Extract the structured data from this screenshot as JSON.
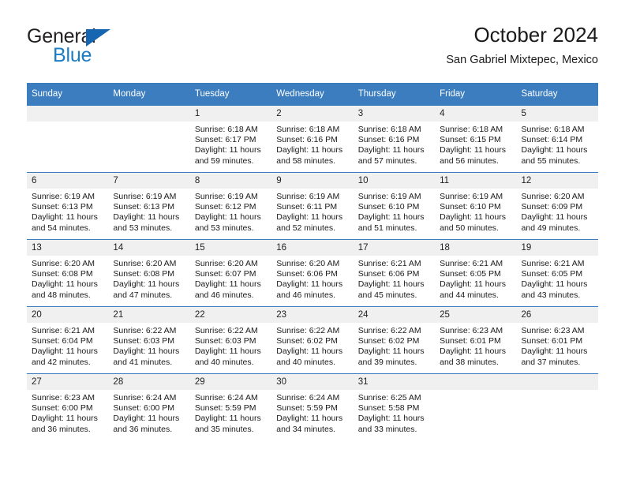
{
  "brand": {
    "name_top": "General",
    "name_bottom": "Blue",
    "triangle_color": "#1565b0",
    "text_color_top": "#231f20",
    "text_color_bottom": "#1a7cc4"
  },
  "header": {
    "title": "October 2024",
    "subtitle": "San Gabriel Mixtepec, Mexico"
  },
  "theme": {
    "header_row_bg": "#3b7dbf",
    "header_row_text": "#ffffff",
    "daynum_bg": "#f0f0f0",
    "week_separator": "#3b7dbf"
  },
  "weekdays": [
    "Sunday",
    "Monday",
    "Tuesday",
    "Wednesday",
    "Thursday",
    "Friday",
    "Saturday"
  ],
  "labels": {
    "sunrise_prefix": "Sunrise:",
    "sunset_prefix": "Sunset:",
    "daylight_prefix": "Daylight:"
  },
  "weeks": [
    [
      {
        "day": "",
        "blank": true
      },
      {
        "day": "",
        "blank": true
      },
      {
        "day": "1",
        "sunrise": "Sunrise: 6:18 AM",
        "sunset": "Sunset: 6:17 PM",
        "daylight_1": "Daylight: 11 hours",
        "daylight_2": "and 59 minutes."
      },
      {
        "day": "2",
        "sunrise": "Sunrise: 6:18 AM",
        "sunset": "Sunset: 6:16 PM",
        "daylight_1": "Daylight: 11 hours",
        "daylight_2": "and 58 minutes."
      },
      {
        "day": "3",
        "sunrise": "Sunrise: 6:18 AM",
        "sunset": "Sunset: 6:16 PM",
        "daylight_1": "Daylight: 11 hours",
        "daylight_2": "and 57 minutes."
      },
      {
        "day": "4",
        "sunrise": "Sunrise: 6:18 AM",
        "sunset": "Sunset: 6:15 PM",
        "daylight_1": "Daylight: 11 hours",
        "daylight_2": "and 56 minutes."
      },
      {
        "day": "5",
        "sunrise": "Sunrise: 6:18 AM",
        "sunset": "Sunset: 6:14 PM",
        "daylight_1": "Daylight: 11 hours",
        "daylight_2": "and 55 minutes."
      }
    ],
    [
      {
        "day": "6",
        "sunrise": "Sunrise: 6:19 AM",
        "sunset": "Sunset: 6:13 PM",
        "daylight_1": "Daylight: 11 hours",
        "daylight_2": "and 54 minutes."
      },
      {
        "day": "7",
        "sunrise": "Sunrise: 6:19 AM",
        "sunset": "Sunset: 6:13 PM",
        "daylight_1": "Daylight: 11 hours",
        "daylight_2": "and 53 minutes."
      },
      {
        "day": "8",
        "sunrise": "Sunrise: 6:19 AM",
        "sunset": "Sunset: 6:12 PM",
        "daylight_1": "Daylight: 11 hours",
        "daylight_2": "and 53 minutes."
      },
      {
        "day": "9",
        "sunrise": "Sunrise: 6:19 AM",
        "sunset": "Sunset: 6:11 PM",
        "daylight_1": "Daylight: 11 hours",
        "daylight_2": "and 52 minutes."
      },
      {
        "day": "10",
        "sunrise": "Sunrise: 6:19 AM",
        "sunset": "Sunset: 6:10 PM",
        "daylight_1": "Daylight: 11 hours",
        "daylight_2": "and 51 minutes."
      },
      {
        "day": "11",
        "sunrise": "Sunrise: 6:19 AM",
        "sunset": "Sunset: 6:10 PM",
        "daylight_1": "Daylight: 11 hours",
        "daylight_2": "and 50 minutes."
      },
      {
        "day": "12",
        "sunrise": "Sunrise: 6:20 AM",
        "sunset": "Sunset: 6:09 PM",
        "daylight_1": "Daylight: 11 hours",
        "daylight_2": "and 49 minutes."
      }
    ],
    [
      {
        "day": "13",
        "sunrise": "Sunrise: 6:20 AM",
        "sunset": "Sunset: 6:08 PM",
        "daylight_1": "Daylight: 11 hours",
        "daylight_2": "and 48 minutes."
      },
      {
        "day": "14",
        "sunrise": "Sunrise: 6:20 AM",
        "sunset": "Sunset: 6:08 PM",
        "daylight_1": "Daylight: 11 hours",
        "daylight_2": "and 47 minutes."
      },
      {
        "day": "15",
        "sunrise": "Sunrise: 6:20 AM",
        "sunset": "Sunset: 6:07 PM",
        "daylight_1": "Daylight: 11 hours",
        "daylight_2": "and 46 minutes."
      },
      {
        "day": "16",
        "sunrise": "Sunrise: 6:20 AM",
        "sunset": "Sunset: 6:06 PM",
        "daylight_1": "Daylight: 11 hours",
        "daylight_2": "and 46 minutes."
      },
      {
        "day": "17",
        "sunrise": "Sunrise: 6:21 AM",
        "sunset": "Sunset: 6:06 PM",
        "daylight_1": "Daylight: 11 hours",
        "daylight_2": "and 45 minutes."
      },
      {
        "day": "18",
        "sunrise": "Sunrise: 6:21 AM",
        "sunset": "Sunset: 6:05 PM",
        "daylight_1": "Daylight: 11 hours",
        "daylight_2": "and 44 minutes."
      },
      {
        "day": "19",
        "sunrise": "Sunrise: 6:21 AM",
        "sunset": "Sunset: 6:05 PM",
        "daylight_1": "Daylight: 11 hours",
        "daylight_2": "and 43 minutes."
      }
    ],
    [
      {
        "day": "20",
        "sunrise": "Sunrise: 6:21 AM",
        "sunset": "Sunset: 6:04 PM",
        "daylight_1": "Daylight: 11 hours",
        "daylight_2": "and 42 minutes."
      },
      {
        "day": "21",
        "sunrise": "Sunrise: 6:22 AM",
        "sunset": "Sunset: 6:03 PM",
        "daylight_1": "Daylight: 11 hours",
        "daylight_2": "and 41 minutes."
      },
      {
        "day": "22",
        "sunrise": "Sunrise: 6:22 AM",
        "sunset": "Sunset: 6:03 PM",
        "daylight_1": "Daylight: 11 hours",
        "daylight_2": "and 40 minutes."
      },
      {
        "day": "23",
        "sunrise": "Sunrise: 6:22 AM",
        "sunset": "Sunset: 6:02 PM",
        "daylight_1": "Daylight: 11 hours",
        "daylight_2": "and 40 minutes."
      },
      {
        "day": "24",
        "sunrise": "Sunrise: 6:22 AM",
        "sunset": "Sunset: 6:02 PM",
        "daylight_1": "Daylight: 11 hours",
        "daylight_2": "and 39 minutes."
      },
      {
        "day": "25",
        "sunrise": "Sunrise: 6:23 AM",
        "sunset": "Sunset: 6:01 PM",
        "daylight_1": "Daylight: 11 hours",
        "daylight_2": "and 38 minutes."
      },
      {
        "day": "26",
        "sunrise": "Sunrise: 6:23 AM",
        "sunset": "Sunset: 6:01 PM",
        "daylight_1": "Daylight: 11 hours",
        "daylight_2": "and 37 minutes."
      }
    ],
    [
      {
        "day": "27",
        "sunrise": "Sunrise: 6:23 AM",
        "sunset": "Sunset: 6:00 PM",
        "daylight_1": "Daylight: 11 hours",
        "daylight_2": "and 36 minutes."
      },
      {
        "day": "28",
        "sunrise": "Sunrise: 6:24 AM",
        "sunset": "Sunset: 6:00 PM",
        "daylight_1": "Daylight: 11 hours",
        "daylight_2": "and 36 minutes."
      },
      {
        "day": "29",
        "sunrise": "Sunrise: 6:24 AM",
        "sunset": "Sunset: 5:59 PM",
        "daylight_1": "Daylight: 11 hours",
        "daylight_2": "and 35 minutes."
      },
      {
        "day": "30",
        "sunrise": "Sunrise: 6:24 AM",
        "sunset": "Sunset: 5:59 PM",
        "daylight_1": "Daylight: 11 hours",
        "daylight_2": "and 34 minutes."
      },
      {
        "day": "31",
        "sunrise": "Sunrise: 6:25 AM",
        "sunset": "Sunset: 5:58 PM",
        "daylight_1": "Daylight: 11 hours",
        "daylight_2": "and 33 minutes."
      },
      {
        "day": "",
        "blank": true
      },
      {
        "day": "",
        "blank": true
      }
    ]
  ]
}
